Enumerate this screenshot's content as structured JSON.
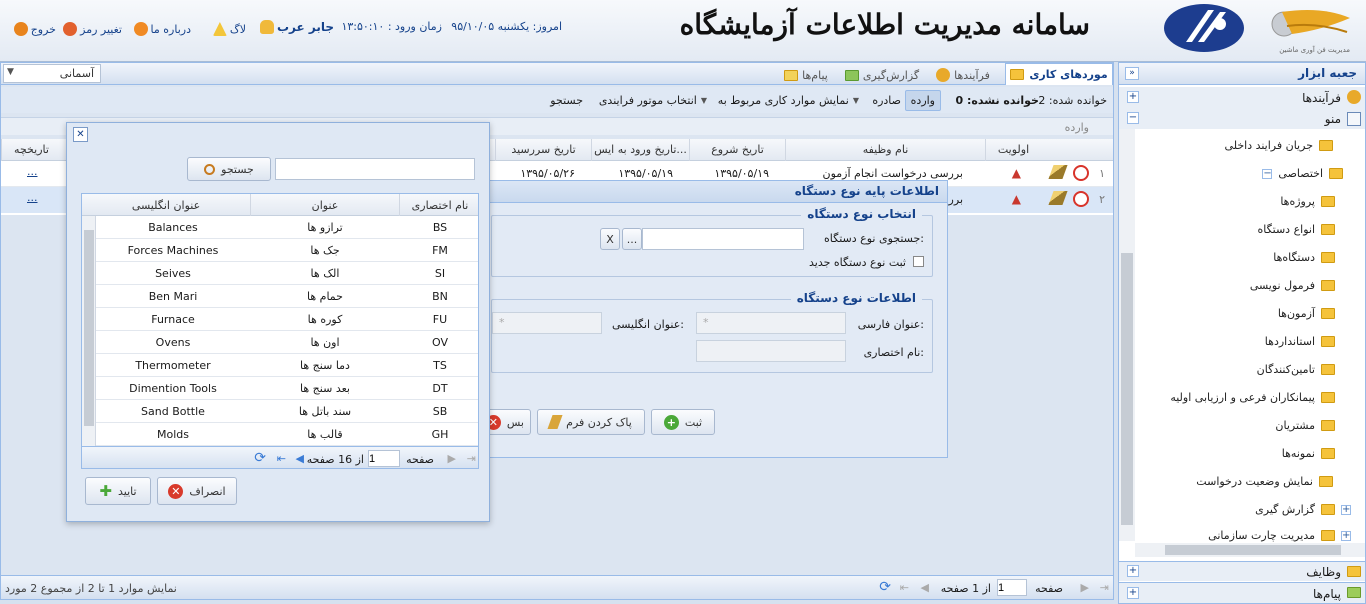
{
  "header": {
    "system_title": "سامانه مدیریت اطلاعات آزمایشگاه",
    "today": "امروز: یکشنبه ۹۵/۱۰/۰۵",
    "login_time": "زمان ورود : ۱۳:۵۰:۱۰",
    "user": "جابر عرب",
    "links": {
      "log": "لاگ",
      "about": "درباره ما",
      "change_password": "تغییر رمز",
      "logout": "خروج"
    },
    "company_caption": "مدیریت فن آوری ماشین"
  },
  "theme_select": "آسمانی",
  "tabs": [
    "موردهای کاری",
    "فرآیندها",
    "گزارش‌گیری",
    "پیام‌ها"
  ],
  "work_toolbar": {
    "read": "خوانده شده: 2",
    "unread": "خوانده نشده: 0",
    "inbox": "وارده",
    "outbox": "صادره",
    "show_related": "نمایش موارد کاری مربوط به",
    "select_engine": "انتخاب موتور فرایندی",
    "search": "جستجو",
    "group": "وارده"
  },
  "grid": {
    "columns": [
      "اولویت",
      "نام وظیفه",
      "تاریخ شروع",
      "تاریخ ورود به ایس...",
      "تاریخ سررسید",
      "تاریخچه"
    ],
    "rows": [
      {
        "num": "۱",
        "task": "بررسی درخواست انجام آزمون",
        "start": "۱۳۹۵/۰۵/۱۹",
        "entry": "۱۳۹۵/۰۵/۱۹",
        "due": "۱۳۹۵/۰۵/۲۶",
        "history": "..."
      },
      {
        "num": "۲",
        "task": "بررسی",
        "start": "",
        "entry": "",
        "due": "",
        "history": "..."
      }
    ]
  },
  "paging": {
    "page_label": "صفحه",
    "page_value": "1",
    "of_pages": "از 1 صفحه",
    "summary": "نمایش موارد 1 تا 2 از مجموع 2 مورد"
  },
  "sidebar": {
    "toolbox": "جعبه ابزار",
    "processes": "فرآیندها",
    "menu": "منو",
    "items": [
      "جریان فرایند داخلی",
      "اختصاصی",
      "پروژه‌ها",
      "انواع دستگاه",
      "دستگاه‌ها",
      "فرمول نویسی",
      "آزمون‌ها",
      "استانداردها",
      "تامین‌کنندگان",
      "پیمانکاران فرعی و ارزیابی اولیه",
      "مشتریان",
      "نمونه‌ها",
      "نمایش وضعیت درخواست",
      "گزارش گیری",
      "مدیریت چارت سازمانی"
    ],
    "tasks": "وظایف",
    "messages": "پیام‌ها"
  },
  "device_dialog": {
    "title": "اطلاعات پایه نوع دستگاه",
    "select_section": "انتخاب نوع دستگاه",
    "search_label": "جستجوی نوع دستگاه:",
    "register_new": "ثبت نوع دستگاه جدید",
    "info_section": "اطلاعات نوع دستگاه",
    "persian_title": "عنوان فارسی:",
    "english_title": "عنوان انگلیسی:",
    "abbr": "نام اختصاری:",
    "required_mark": "*",
    "btn_save": "ثبت",
    "btn_clear": "پاک کردن فرم",
    "btn_cancel_partial": "بس",
    "btn_dots": "...",
    "btn_x": "X"
  },
  "lookup_modal": {
    "search_btn": "جستجو",
    "columns": [
      "نام اختصاری",
      "عنوان",
      "عنوان انگلیسی"
    ],
    "rows": [
      {
        "abbr": "BS",
        "title": "ترازو ها",
        "en": "Balances"
      },
      {
        "abbr": "FM",
        "title": "جک ها",
        "en": "Forces Machines"
      },
      {
        "abbr": "SI",
        "title": "الک ها",
        "en": "Seives"
      },
      {
        "abbr": "BN",
        "title": "حمام ها",
        "en": "Ben Mari"
      },
      {
        "abbr": "FU",
        "title": "کوره ها",
        "en": "Furnace"
      },
      {
        "abbr": "OV",
        "title": "اون ها",
        "en": "Ovens"
      },
      {
        "abbr": "TS",
        "title": "دما سنج ها",
        "en": "Thermometer"
      },
      {
        "abbr": "DT",
        "title": "بعد سنج ها",
        "en": "Dimention Tools"
      },
      {
        "abbr": "SB",
        "title": "سند باتل ها",
        "en": "Sand Bottle"
      },
      {
        "abbr": "GH",
        "title": "قالب ها",
        "en": "Molds"
      }
    ],
    "page_label": "صفحه",
    "page_value": "1",
    "of_pages": "از 16 صفحه",
    "btn_cancel": "انصراف",
    "btn_confirm": "تایید",
    "close": "✕"
  }
}
